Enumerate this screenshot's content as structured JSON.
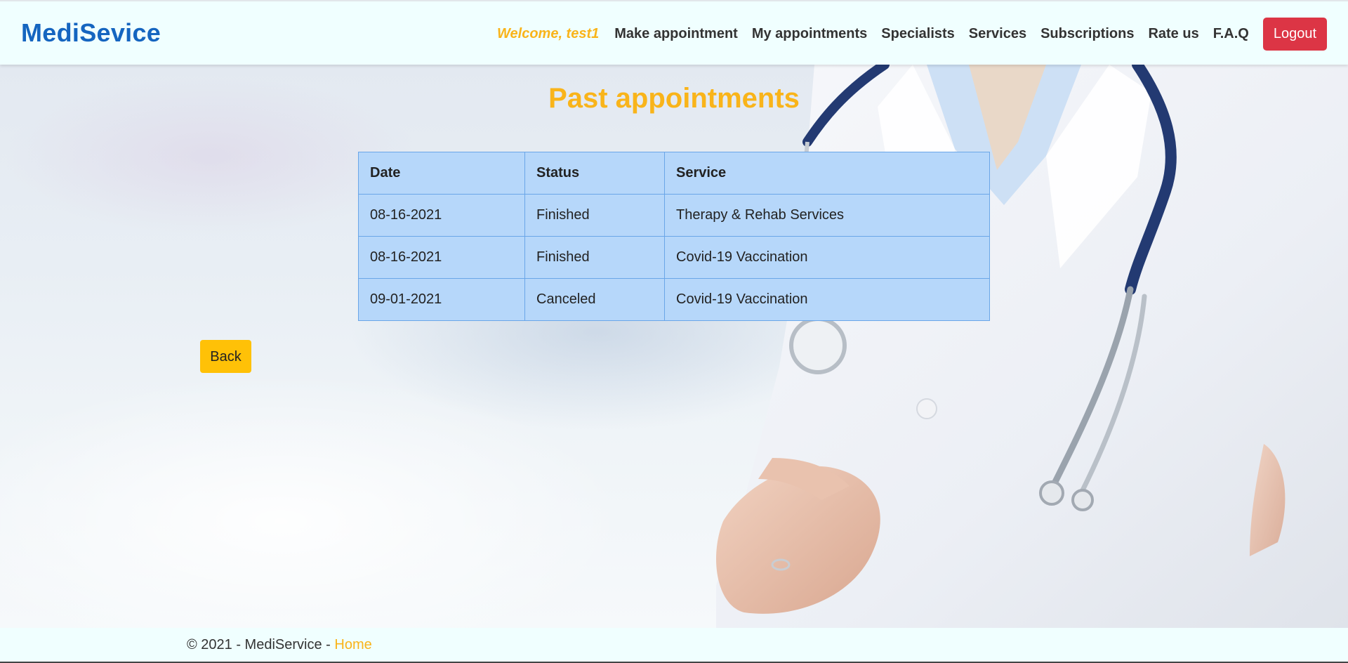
{
  "navbar": {
    "brand": "MediSevice",
    "welcome": "Welcome, test1",
    "links": [
      "Make appointment",
      "My appointments",
      "Specialists",
      "Services",
      "Subscriptions",
      "Rate us",
      "F.A.Q"
    ],
    "logout_label": "Logout"
  },
  "main": {
    "title": "Past appointments",
    "table": {
      "headers": [
        "Date",
        "Status",
        "Service"
      ],
      "rows": [
        [
          "08-16-2021",
          "Finished",
          "Therapy & Rehab Services"
        ],
        [
          "08-16-2021",
          "Finished",
          "Covid-19 Vaccination"
        ],
        [
          "09-01-2021",
          "Canceled",
          "Covid-19 Vaccination"
        ]
      ]
    },
    "back_label": "Back"
  },
  "footer": {
    "copyright": "© 2021 - MediService - ",
    "home_link": "Home"
  },
  "colors": {
    "brand": "#1565c0",
    "accent": "#f9b41a",
    "logout": "#dc3545",
    "back": "#ffc107",
    "table_cell": "#b6d7fa",
    "table_border": "#6aa6e8"
  },
  "background_image": "doctor in white coat with stethoscope"
}
